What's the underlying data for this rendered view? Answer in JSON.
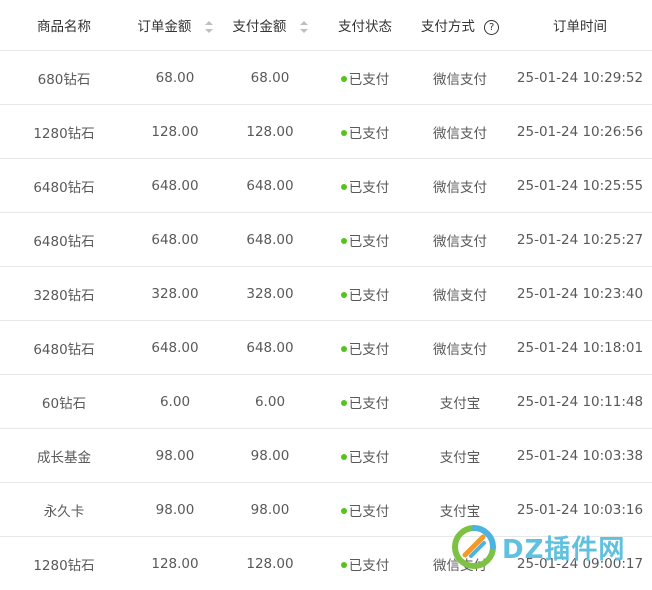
{
  "table": {
    "headers": {
      "product_name": "商品名称",
      "order_amount": "订单金额",
      "pay_amount": "支付金额",
      "pay_status": "支付状态",
      "pay_method": "支付方式",
      "order_time": "订单时间"
    },
    "help_icon_glyph": "?",
    "status_color": "#52c41a",
    "rows": [
      {
        "product": "680钻石",
        "order_amount": "68.00",
        "pay_amount": "68.00",
        "status": "已支付",
        "method": "微信支付",
        "time": "25-01-24 10:29:52"
      },
      {
        "product": "1280钻石",
        "order_amount": "128.00",
        "pay_amount": "128.00",
        "status": "已支付",
        "method": "微信支付",
        "time": "25-01-24 10:26:56"
      },
      {
        "product": "6480钻石",
        "order_amount": "648.00",
        "pay_amount": "648.00",
        "status": "已支付",
        "method": "微信支付",
        "time": "25-01-24 10:25:55"
      },
      {
        "product": "6480钻石",
        "order_amount": "648.00",
        "pay_amount": "648.00",
        "status": "已支付",
        "method": "微信支付",
        "time": "25-01-24 10:25:27"
      },
      {
        "product": "3280钻石",
        "order_amount": "328.00",
        "pay_amount": "328.00",
        "status": "已支付",
        "method": "微信支付",
        "time": "25-01-24 10:23:40"
      },
      {
        "product": "6480钻石",
        "order_amount": "648.00",
        "pay_amount": "648.00",
        "status": "已支付",
        "method": "微信支付",
        "time": "25-01-24 10:18:01"
      },
      {
        "product": "60钻石",
        "order_amount": "6.00",
        "pay_amount": "6.00",
        "status": "已支付",
        "method": "支付宝",
        "time": "25-01-24 10:11:48"
      },
      {
        "product": "成长基金",
        "order_amount": "98.00",
        "pay_amount": "98.00",
        "status": "已支付",
        "method": "支付宝",
        "time": "25-01-24 10:03:38"
      },
      {
        "product": "永久卡",
        "order_amount": "98.00",
        "pay_amount": "98.00",
        "status": "已支付",
        "method": "支付宝",
        "time": "25-01-24 10:03:16"
      },
      {
        "product": "1280钻石",
        "order_amount": "128.00",
        "pay_amount": "128.00",
        "status": "已支付",
        "method": "微信支付",
        "time": "25-01-24 09:00:17"
      }
    ]
  },
  "watermark": {
    "text": "DZ插件网"
  }
}
